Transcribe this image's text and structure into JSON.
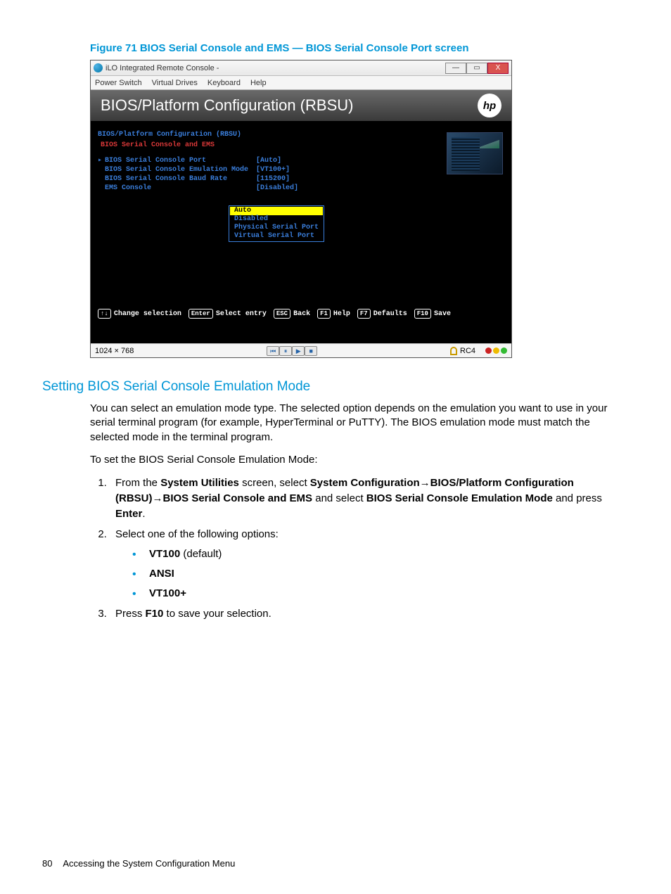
{
  "figure": {
    "caption": "Figure 71 BIOS Serial Console and EMS — BIOS Serial Console Port screen"
  },
  "window": {
    "title": "iLO Integrated Remote Console -",
    "menu": [
      "Power Switch",
      "Virtual Drives",
      "Keyboard",
      "Help"
    ],
    "btn_min": "—",
    "btn_max": "▭",
    "btn_close": "X"
  },
  "bios": {
    "title": "BIOS/Platform Configuration (RBSU)",
    "logo": "hp",
    "crumb1": "BIOS/Platform Configuration (RBSU)",
    "crumb2": "BIOS Serial Console and EMS",
    "options": [
      {
        "label": "BIOS Serial Console Port",
        "value": "[Auto]",
        "selected": true
      },
      {
        "label": "BIOS Serial Console Emulation Mode",
        "value": "[VT100+]"
      },
      {
        "label": "BIOS Serial Console Baud Rate",
        "value": "[115200]"
      },
      {
        "label": "EMS Console",
        "value": "[Disabled]"
      }
    ],
    "popup": [
      "Auto",
      "Disabled",
      "Physical Serial Port",
      "Virtual Serial Port"
    ],
    "footer_keys": [
      {
        "key": "↑↓",
        "label": "Change selection"
      },
      {
        "key": "Enter",
        "label": "Select entry"
      },
      {
        "key": "ESC",
        "label": "Back"
      },
      {
        "key": "F1",
        "label": "Help"
      },
      {
        "key": "F7",
        "label": "Defaults"
      },
      {
        "key": "F10",
        "label": "Save"
      }
    ]
  },
  "statusbar": {
    "resolution": "1024 × 768",
    "rc": "RC4"
  },
  "section": {
    "heading": "Setting BIOS Serial Console Emulation Mode",
    "p1": "You can select an emulation mode type. The selected option depends on the emulation you want to use in your serial terminal program (for example, HyperTerminal or PuTTY). The BIOS emulation mode must match the selected mode in the terminal program.",
    "p2": "To set the BIOS Serial Console Emulation Mode:",
    "step1_a": "From the ",
    "step1_b": "System Utilities",
    "step1_c": " screen, select ",
    "step1_d": "System Configuration",
    "step1_arrow": "→",
    "step1_e": "BIOS/Platform Configuration (RBSU)",
    "step1_f": "BIOS Serial Console and EMS",
    "step1_g": " and select ",
    "step1_h": "BIOS Serial Console Emulation Mode",
    "step1_i": " and press ",
    "step1_j": "Enter",
    "step1_k": ".",
    "step2": "Select one of the following options:",
    "bullets": [
      {
        "strong": "VT100",
        "rest": " (default)"
      },
      {
        "strong": "ANSI",
        "rest": ""
      },
      {
        "strong": "VT100+",
        "rest": ""
      }
    ],
    "step3_a": "Press ",
    "step3_b": "F10",
    "step3_c": " to save your selection."
  },
  "footer": {
    "page": "80",
    "title": "Accessing the System Configuration Menu"
  }
}
